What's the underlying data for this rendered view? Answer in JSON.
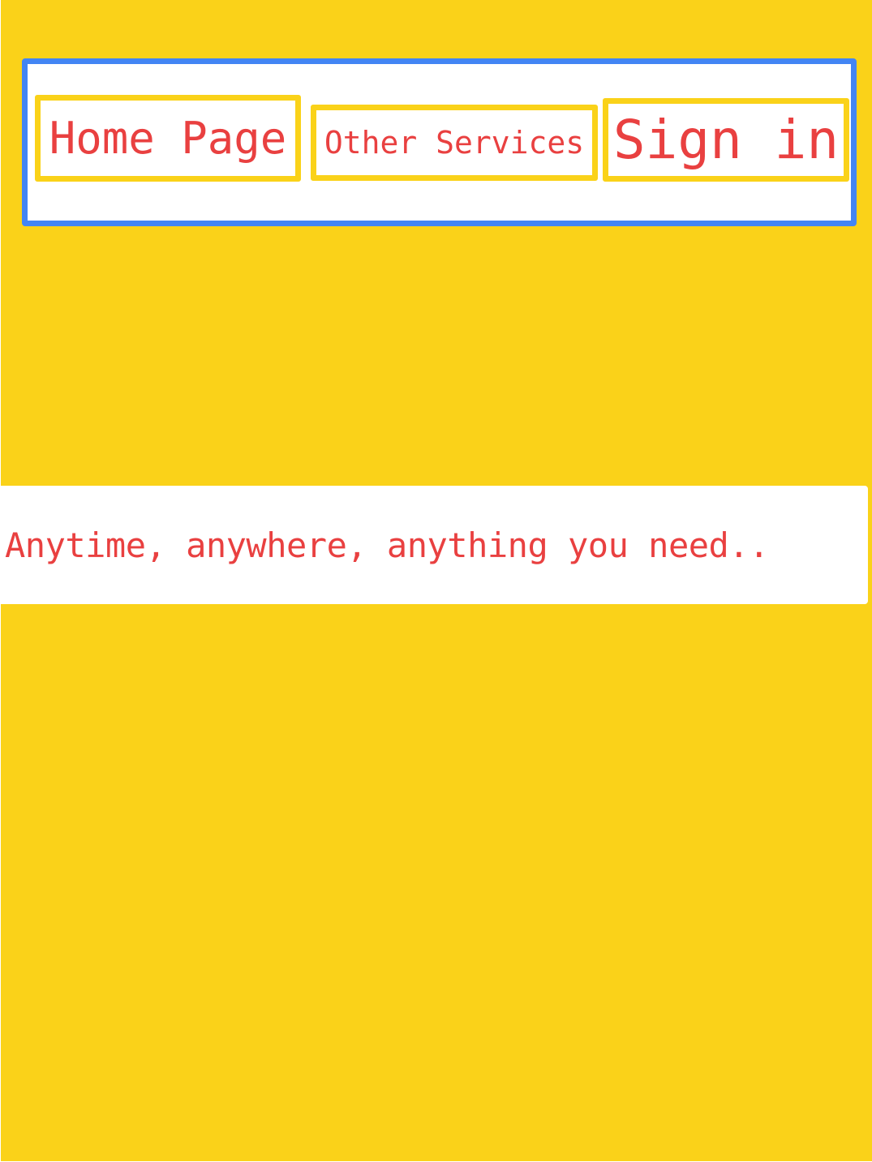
{
  "nav": {
    "home_label": "Home Page",
    "services_label": "Other Services",
    "signin_label": "Sign in"
  },
  "hero": {
    "tagline": "Anytime, anywhere, anything you need.."
  },
  "colors": {
    "background": "#fad219",
    "nav_border": "#4285f4",
    "button_border": "#fad219",
    "text": "#e94040",
    "surface": "#ffffff"
  }
}
